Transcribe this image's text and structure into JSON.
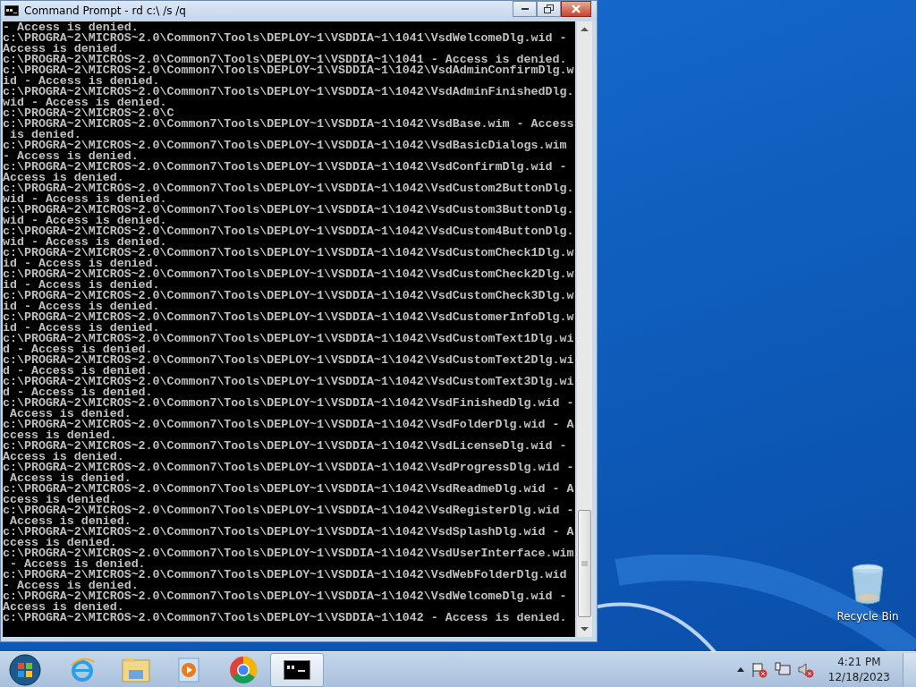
{
  "window": {
    "title": "Command Prompt - rd  c:\\ /s /q"
  },
  "console": {
    "lines": [
      "- Access is denied.",
      "c:\\PROGRA~2\\MICROS~2.0\\Common7\\Tools\\DEPLOY~1\\VSDDIA~1\\1041\\VsdWelcomeDlg.wid -",
      "Access is denied.",
      "c:\\PROGRA~2\\MICROS~2.0\\Common7\\Tools\\DEPLOY~1\\VSDDIA~1\\1041 - Access is denied.",
      "c:\\PROGRA~2\\MICROS~2.0\\Common7\\Tools\\DEPLOY~1\\VSDDIA~1\\1042\\VsdAdminConfirmDlg.w",
      "id - Access is denied.",
      "c:\\PROGRA~2\\MICROS~2.0\\Common7\\Tools\\DEPLOY~1\\VSDDIA~1\\1042\\VsdAdminFinishedDlg.",
      "wid - Access is denied.",
      "c:\\PROGRA~2\\MICROS~2.0\\C",
      "c:\\PROGRA~2\\MICROS~2.0\\Common7\\Tools\\DEPLOY~1\\VSDDIA~1\\1042\\VsdBase.wim - Access",
      " is denied.",
      "c:\\PROGRA~2\\MICROS~2.0\\Common7\\Tools\\DEPLOY~1\\VSDDIA~1\\1042\\VsdBasicDialogs.wim",
      "- Access is denied.",
      "c:\\PROGRA~2\\MICROS~2.0\\Common7\\Tools\\DEPLOY~1\\VSDDIA~1\\1042\\VsdConfirmDlg.wid -",
      "Access is denied.",
      "c:\\PROGRA~2\\MICROS~2.0\\Common7\\Tools\\DEPLOY~1\\VSDDIA~1\\1042\\VsdCustom2ButtonDlg.",
      "wid - Access is denied.",
      "c:\\PROGRA~2\\MICROS~2.0\\Common7\\Tools\\DEPLOY~1\\VSDDIA~1\\1042\\VsdCustom3ButtonDlg.",
      "wid - Access is denied.",
      "c:\\PROGRA~2\\MICROS~2.0\\Common7\\Tools\\DEPLOY~1\\VSDDIA~1\\1042\\VsdCustom4ButtonDlg.",
      "wid - Access is denied.",
      "c:\\PROGRA~2\\MICROS~2.0\\Common7\\Tools\\DEPLOY~1\\VSDDIA~1\\1042\\VsdCustomCheck1Dlg.w",
      "id - Access is denied.",
      "c:\\PROGRA~2\\MICROS~2.0\\Common7\\Tools\\DEPLOY~1\\VSDDIA~1\\1042\\VsdCustomCheck2Dlg.w",
      "id - Access is denied.",
      "c:\\PROGRA~2\\MICROS~2.0\\Common7\\Tools\\DEPLOY~1\\VSDDIA~1\\1042\\VsdCustomCheck3Dlg.w",
      "id - Access is denied.",
      "c:\\PROGRA~2\\MICROS~2.0\\Common7\\Tools\\DEPLOY~1\\VSDDIA~1\\1042\\VsdCustomerInfoDlg.w",
      "id - Access is denied.",
      "c:\\PROGRA~2\\MICROS~2.0\\Common7\\Tools\\DEPLOY~1\\VSDDIA~1\\1042\\VsdCustomText1Dlg.wi",
      "d - Access is denied.",
      "c:\\PROGRA~2\\MICROS~2.0\\Common7\\Tools\\DEPLOY~1\\VSDDIA~1\\1042\\VsdCustomText2Dlg.wi",
      "d - Access is denied.",
      "c:\\PROGRA~2\\MICROS~2.0\\Common7\\Tools\\DEPLOY~1\\VSDDIA~1\\1042\\VsdCustomText3Dlg.wi",
      "d - Access is denied.",
      "c:\\PROGRA~2\\MICROS~2.0\\Common7\\Tools\\DEPLOY~1\\VSDDIA~1\\1042\\VsdFinishedDlg.wid -",
      " Access is denied.",
      "c:\\PROGRA~2\\MICROS~2.0\\Common7\\Tools\\DEPLOY~1\\VSDDIA~1\\1042\\VsdFolderDlg.wid - A",
      "ccess is denied.",
      "c:\\PROGRA~2\\MICROS~2.0\\Common7\\Tools\\DEPLOY~1\\VSDDIA~1\\1042\\VsdLicenseDlg.wid -",
      "Access is denied.",
      "c:\\PROGRA~2\\MICROS~2.0\\Common7\\Tools\\DEPLOY~1\\VSDDIA~1\\1042\\VsdProgressDlg.wid -",
      " Access is denied.",
      "c:\\PROGRA~2\\MICROS~2.0\\Common7\\Tools\\DEPLOY~1\\VSDDIA~1\\1042\\VsdReadmeDlg.wid - A",
      "ccess is denied.",
      "c:\\PROGRA~2\\MICROS~2.0\\Common7\\Tools\\DEPLOY~1\\VSDDIA~1\\1042\\VsdRegisterDlg.wid -",
      " Access is denied.",
      "c:\\PROGRA~2\\MICROS~2.0\\Common7\\Tools\\DEPLOY~1\\VSDDIA~1\\1042\\VsdSplashDlg.wid - A",
      "ccess is denied.",
      "c:\\PROGRA~2\\MICROS~2.0\\Common7\\Tools\\DEPLOY~1\\VSDDIA~1\\1042\\VsdUserInterface.wim",
      " - Access is denied.",
      "c:\\PROGRA~2\\MICROS~2.0\\Common7\\Tools\\DEPLOY~1\\VSDDIA~1\\1042\\VsdWebFolderDlg.wid",
      "- Access is denied.",
      "c:\\PROGRA~2\\MICROS~2.0\\Common7\\Tools\\DEPLOY~1\\VSDDIA~1\\1042\\VsdWelcomeDlg.wid -",
      "Access is denied.",
      "c:\\PROGRA~2\\MICROS~2.0\\Common7\\Tools\\DEPLOY~1\\VSDDIA~1\\1042 - Access is denied."
    ]
  },
  "desktop_icons": [
    {
      "label": "Recycle Bin"
    }
  ],
  "taskbar": {
    "buttons": [
      {
        "kind": "start",
        "selected": false
      },
      {
        "kind": "browser-e",
        "selected": false
      },
      {
        "kind": "folder",
        "selected": false
      },
      {
        "kind": "player",
        "selected": false
      },
      {
        "kind": "browser-circle",
        "selected": false
      },
      {
        "kind": "console",
        "selected": true
      }
    ],
    "clock": {
      "time": "4:21 PM",
      "date": "12/18/2023"
    }
  }
}
